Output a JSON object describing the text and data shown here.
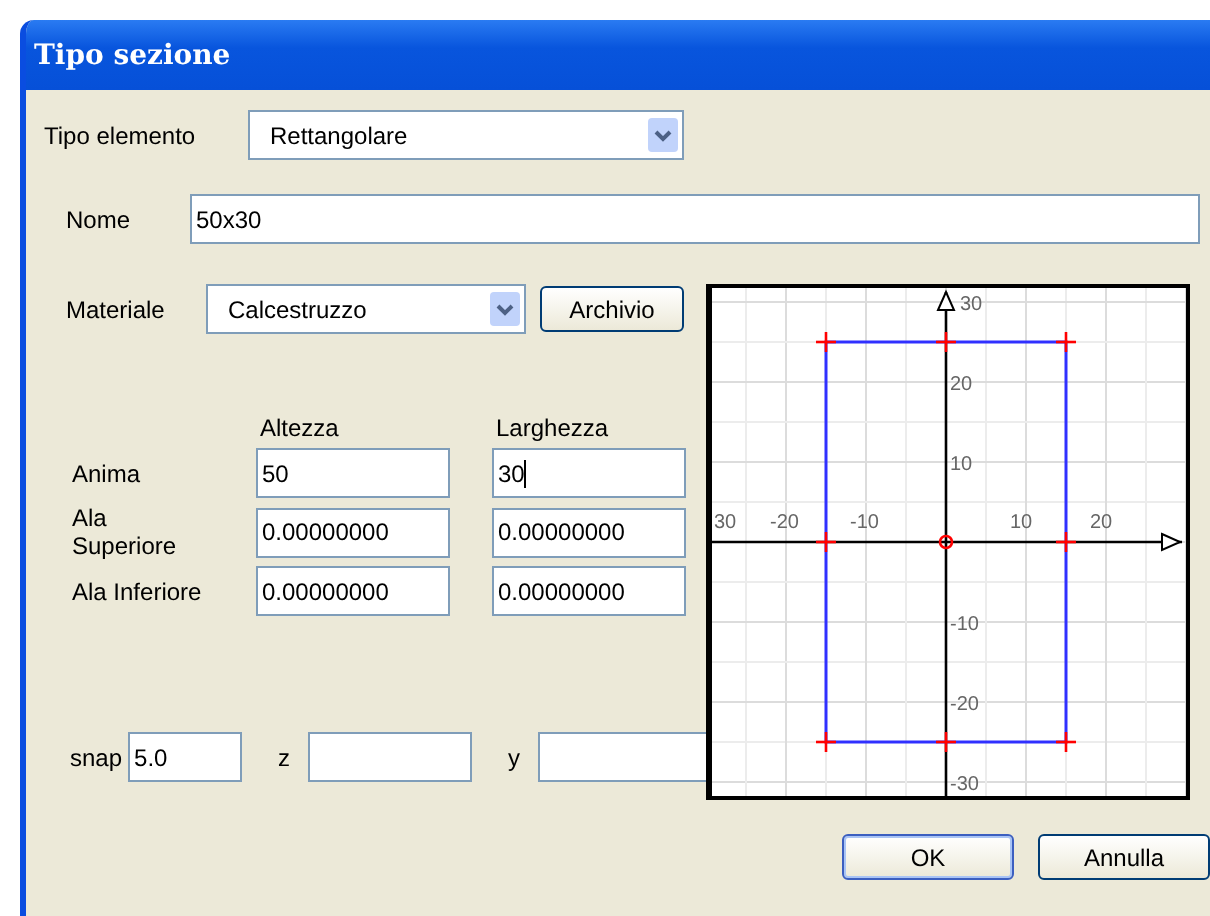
{
  "window": {
    "title": "Tipo sezione"
  },
  "tipo_elemento": {
    "label": "Tipo elemento",
    "value": "Rettangolare"
  },
  "nome": {
    "label": "Nome",
    "value": "50x30"
  },
  "materiale": {
    "label": "Materiale",
    "value": "Calcestruzzo",
    "button": "Archivio"
  },
  "dimensions": {
    "columns": [
      "Altezza",
      "Larghezza"
    ],
    "rows": [
      {
        "label": "Anima",
        "values": [
          "50",
          "30"
        ],
        "focused": [
          false,
          true
        ]
      },
      {
        "label": "Ala Superiore",
        "values": [
          "0.00000000",
          "0.00000000"
        ],
        "focused": [
          false,
          false
        ]
      },
      {
        "label": "Ala Inferiore",
        "values": [
          "0.00000000",
          "0.00000000"
        ],
        "focused": [
          false,
          false
        ]
      }
    ]
  },
  "snap_row": [
    {
      "label": "snap",
      "value": "5.0"
    },
    {
      "label": "z"
    },
    {
      "label": "y"
    }
  ],
  "section_plot": {
    "x_tick_labels": [
      "30",
      "-20",
      "-10",
      "10",
      "20"
    ],
    "y_tick_labels": [
      "30",
      "20",
      "10",
      "-10",
      "-20",
      "-30"
    ]
  },
  "buttons": [
    "OK",
    "Annulla"
  ]
}
